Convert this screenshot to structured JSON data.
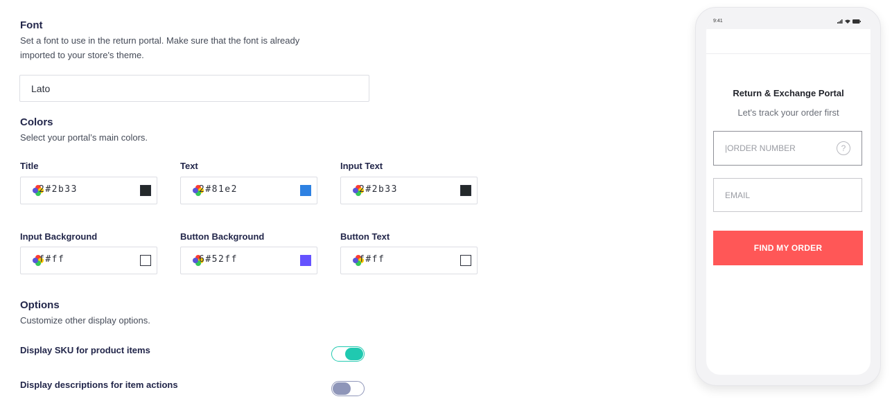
{
  "font": {
    "title": "Font",
    "description_line1": "Set a font to use in the return portal. Make sure that the font is already",
    "description_line2": "imported to your store's theme.",
    "value": "Lato"
  },
  "colors": {
    "title": "Colors",
    "description": "Select your portal’s main colors.",
    "fields": [
      {
        "label": "Title",
        "value": "2#2b33",
        "swatch": "#24292b"
      },
      {
        "label": "Text",
        "value": "2#81e2",
        "swatch": "#2e81e2"
      },
      {
        "label": "Input Text",
        "value": "2#2b33",
        "swatch": "#24292b"
      },
      {
        "label": "Input Background",
        "value": "f#ff",
        "swatch": "#ffffff"
      },
      {
        "label": "Button Background",
        "value": "6#52ff",
        "swatch": "#6552ff"
      },
      {
        "label": "Button Text",
        "value": "f#ff",
        "swatch": "#ffffff"
      }
    ]
  },
  "options": {
    "title": "Options",
    "description": "Customize other display options.",
    "items": [
      {
        "label": "Display SKU for product items",
        "enabled": true
      },
      {
        "label": "Display descriptions for item actions",
        "enabled": false
      }
    ]
  },
  "preview": {
    "status_time": "9:41",
    "portal_title": "Return & Exchange Portal",
    "portal_subtitle": "Let's track your order first",
    "order_placeholder": "|ORDER NUMBER",
    "email_placeholder": "EMAIL",
    "button_label": "FIND MY ORDER",
    "button_color": "#ff5757"
  },
  "icons": {
    "picker": "color-picker-icon",
    "help": "question-icon"
  }
}
